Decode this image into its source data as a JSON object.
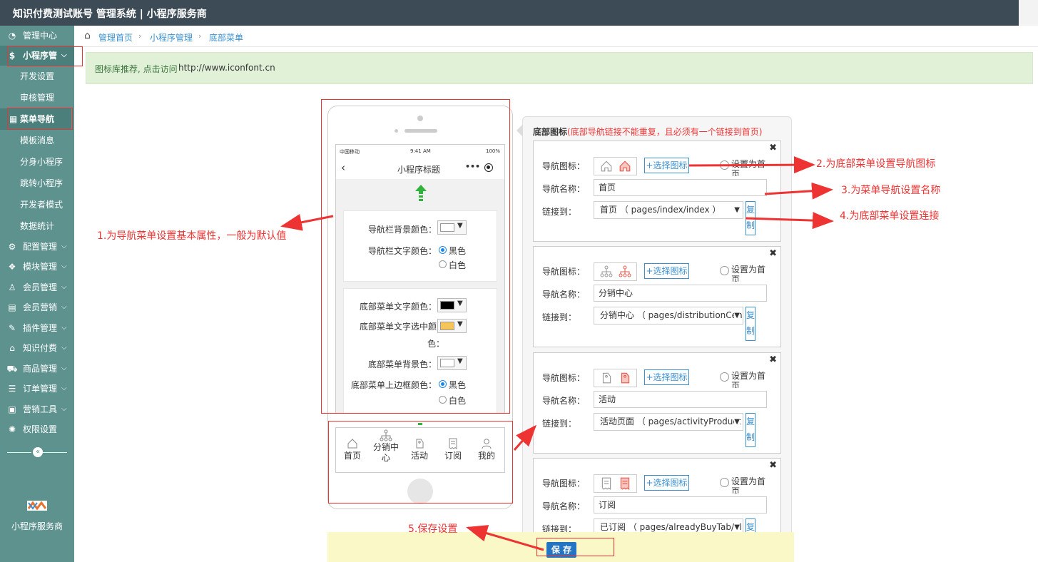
{
  "app_title": "知识付费测试账号 管理系统 | 小程序服务商",
  "sidebar": {
    "items": [
      {
        "label": "管理中心",
        "icon": "dashboard-icon"
      },
      {
        "label": "小程序管",
        "icon": "dollar-icon",
        "expanded": true
      },
      {
        "label": "配置管理",
        "icon": "cogs-icon"
      },
      {
        "label": "模块管理",
        "icon": "cubes-icon"
      },
      {
        "label": "会员管理",
        "icon": "user-icon"
      },
      {
        "label": "会员营销",
        "icon": "id-card-icon"
      },
      {
        "label": "插件管理",
        "icon": "plug-icon"
      },
      {
        "label": "知识付费",
        "icon": "home-icon"
      },
      {
        "label": "商品管理",
        "icon": "cart-icon"
      },
      {
        "label": "订单管理",
        "icon": "list-icon"
      },
      {
        "label": "营销工具",
        "icon": "briefcase-icon"
      },
      {
        "label": "权限设置",
        "icon": "gear-icon"
      }
    ],
    "subitems": [
      "开发设置",
      "审核管理",
      "菜单导航",
      "模板消息",
      "分身小程序",
      "跳转小程序",
      "开发者模式",
      "数据统计"
    ],
    "active_sub": "菜单导航",
    "brand": "小程序服务商"
  },
  "breadcrumb": [
    "管理首页",
    "小程序管理",
    "底部菜单"
  ],
  "tip": {
    "text": "图标库推荐, 点击访问",
    "url": "http://www.iconfont.cn"
  },
  "phone": {
    "status_carrier": "中国移动",
    "status_time": "9:41 AM",
    "status_battery": "100%",
    "title": "小程序标题",
    "more": "•••",
    "settings": {
      "nav_bg_label": "导航栏背景颜色：",
      "nav_text_label": "导航栏文字颜色：",
      "opt_black": "黑色",
      "opt_white": "白色",
      "tab_text_label": "底部菜单文字颜色：",
      "tab_sel_label_1": "底部菜单文字选中颜",
      "tab_sel_label_2": "色：",
      "tab_bg_label": "底部菜单背景色：",
      "tab_border_label": "底部菜单上边框颜色："
    },
    "colors": {
      "nav_bg": "#ffffff",
      "tab_text": "#000000",
      "tab_selected": "#f5c55a",
      "tab_bg": "#ffffff"
    },
    "tabs": [
      {
        "label": "首页",
        "icon": "home-icon"
      },
      {
        "label": "分销中心",
        "icon": "sitemap-icon"
      },
      {
        "label": "活动",
        "icon": "tag-icon"
      },
      {
        "label": "订阅",
        "icon": "receipt-icon"
      },
      {
        "label": "我的",
        "icon": "user-icon"
      }
    ]
  },
  "panel": {
    "title": "底部图标",
    "warning": "(底部导航链接不能重复，且必须有一个链接到首页)",
    "icon_label": "导航图标：",
    "name_label": "导航名称：",
    "link_label": "链接到：",
    "pick_label": "+选择图标",
    "home_label": "设置为首页",
    "copy_label": "复制",
    "close": "✖",
    "items": [
      {
        "name": "首页",
        "link": "首页 （ pages/index/index ）",
        "icon": "home-icon"
      },
      {
        "name": "分销中心",
        "link": "分销中心 （ pages/distributionCen",
        "icon": "sitemap-icon"
      },
      {
        "name": "活动",
        "link": "活动页面 （ pages/activityProduct",
        "icon": "tag-icon"
      },
      {
        "name": "订阅",
        "link": "已订阅 （ pages/alreadyBuyTab/al",
        "icon": "receipt-icon"
      }
    ]
  },
  "save_label": "保 存",
  "annotations": {
    "a1": "1.为导航菜单设置基本属性，一般为默认值",
    "a2": "2.为底部菜单设置导航图标",
    "a3": "3.为菜单导航设置名称",
    "a4": "4.为底部菜单设置连接",
    "a5": "5.保存设置"
  }
}
